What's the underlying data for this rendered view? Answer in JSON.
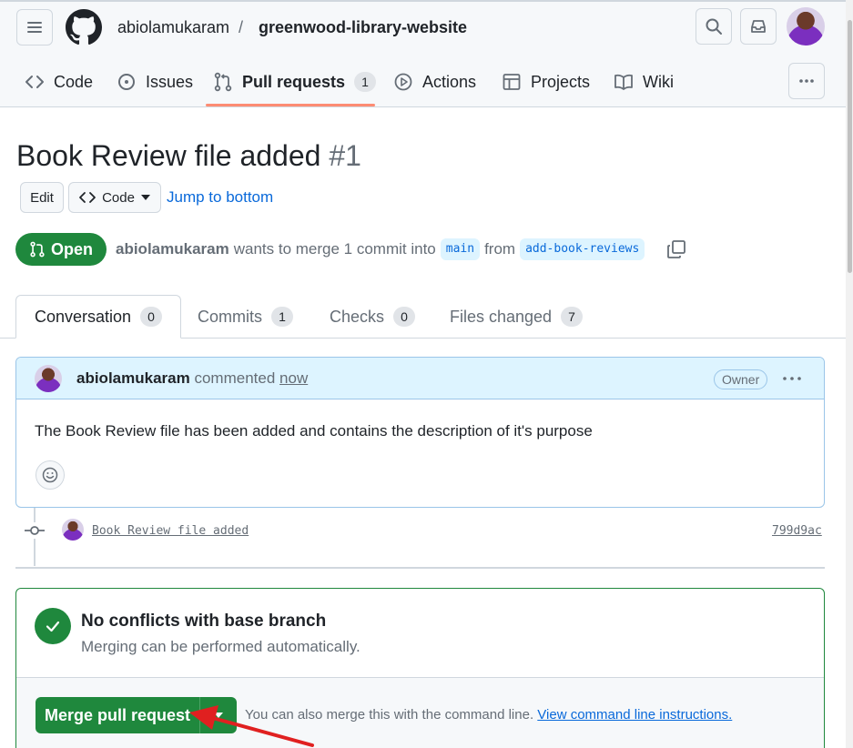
{
  "header": {
    "owner": "abiolamukaram",
    "separator": "/",
    "repo": "greenwood-library-website"
  },
  "nav": {
    "code": "Code",
    "issues": "Issues",
    "pull_requests": "Pull requests",
    "pull_requests_count": "1",
    "actions": "Actions",
    "projects": "Projects",
    "wiki": "Wiki"
  },
  "pr": {
    "title": "Book Review file added",
    "number": "#1",
    "edit_label": "Edit",
    "code_label": "Code",
    "jump_label": "Jump to bottom",
    "state": "Open",
    "author": "abiolamukaram",
    "summary_text": "wants to merge 1 commit into",
    "base_branch": "main",
    "from_text": "from",
    "head_branch": "add-book-reviews"
  },
  "tabs": [
    {
      "label": "Conversation",
      "count": "0"
    },
    {
      "label": "Commits",
      "count": "1"
    },
    {
      "label": "Checks",
      "count": "0"
    },
    {
      "label": "Files changed",
      "count": "7"
    }
  ],
  "comment": {
    "author": "abiolamukaram",
    "action": "commented",
    "time": "now",
    "role": "Owner",
    "body": "The Book Review file has been added and contains the description of it's purpose"
  },
  "commit": {
    "message": "Book Review file added",
    "sha": "799d9ac"
  },
  "merge": {
    "status_title": "No conflicts with base branch",
    "status_subtitle": "Merging can be performed automatically.",
    "button_label": "Merge pull request",
    "cli_text": "You can also merge this with the command line.",
    "cli_link": "View command line instructions."
  },
  "colors": {
    "merge_green": "#1f883d",
    "link_blue": "#0969da",
    "annotation_arrow": "#e02020"
  },
  "icons": [
    "menu-icon",
    "github-logo-icon",
    "search-icon",
    "inbox-icon",
    "code-icon",
    "issue-icon",
    "pull-request-icon",
    "play-icon",
    "table-icon",
    "book-icon",
    "kebab-icon",
    "copy-icon",
    "smiley-icon",
    "commit-icon",
    "check-icon",
    "triangle-down-icon"
  ]
}
